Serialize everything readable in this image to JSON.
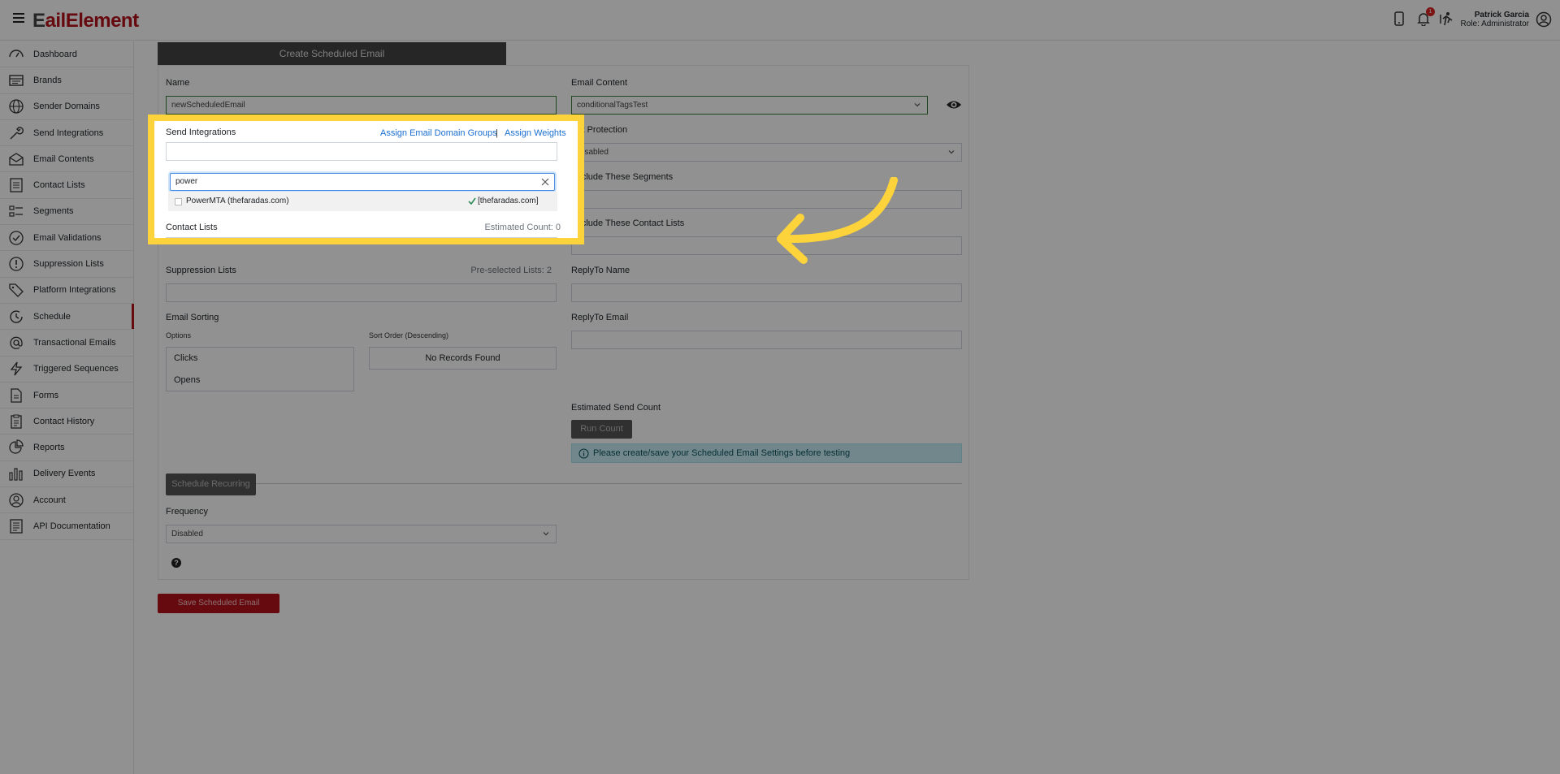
{
  "app": {
    "logo_a": "E",
    "logo_b": "ail",
    "logo_c": "Element"
  },
  "user": {
    "name": "Patrick Garcia",
    "role": "Role: Administrator",
    "notif_count": "1"
  },
  "sidebar": {
    "items": [
      {
        "label": "Dashboard",
        "icon": "gauge-icon"
      },
      {
        "label": "Brands",
        "icon": "window-icon"
      },
      {
        "label": "Sender Domains",
        "icon": "globe-icon"
      },
      {
        "label": "Send Integrations",
        "icon": "wrench-icon"
      },
      {
        "label": "Email Contents",
        "icon": "envelope-icon"
      },
      {
        "label": "Contact Lists",
        "icon": "list-icon"
      },
      {
        "label": "Segments",
        "icon": "segments-icon"
      },
      {
        "label": "Email Validations",
        "icon": "check-circle-icon"
      },
      {
        "label": "Suppression Lists",
        "icon": "exclamation-icon"
      },
      {
        "label": "Platform Integrations",
        "icon": "tag-icon"
      },
      {
        "label": "Schedule",
        "icon": "clock-icon"
      },
      {
        "label": "Transactional Emails",
        "icon": "at-icon"
      },
      {
        "label": "Triggered Sequences",
        "icon": "bolt-icon"
      },
      {
        "label": "Forms",
        "icon": "form-icon"
      },
      {
        "label": "Contact History",
        "icon": "clipboard-icon"
      },
      {
        "label": "Reports",
        "icon": "pie-icon"
      },
      {
        "label": "Delivery Events",
        "icon": "bar-chart-icon"
      },
      {
        "label": "Account",
        "icon": "user-circle-icon"
      },
      {
        "label": "API Documentation",
        "icon": "doc-icon"
      }
    ],
    "active_index": 10
  },
  "form": {
    "tab_title": "Create Scheduled Email",
    "name_label": "Name",
    "name_value": "newScheduledEmail",
    "email_content_label": "Email Content",
    "email_content_value": "conditionalTagsTest",
    "send_integrations_label": "Send Integrations",
    "assign_domain_groups": "Assign Email Domain Groups",
    "link_sep": "|",
    "assign_weights": "Assign Weights",
    "search_value": "power",
    "option_label": "PowerMTA (thefaradas.com)",
    "option_tag": "[thefaradas.com]",
    "bot_protection_label": "Bot Protection",
    "bot_protection_value": "Disabled",
    "exclude_segments_label": "Exclude These Segments",
    "contact_lists_label": "Contact Lists",
    "estimated_count": "Estimated Count: 0",
    "exclude_contact_lists_label": "Exclude These Contact Lists",
    "suppression_lists_label": "Suppression Lists",
    "preselected_lists": "Pre-selected Lists: 2",
    "replyto_name_label": "ReplyTo Name",
    "email_sorting_label": "Email Sorting",
    "options_label": "Options",
    "sort_order_label": "Sort Order (Descending)",
    "options": [
      "Clicks",
      "Opens"
    ],
    "no_records": "No Records Found",
    "replyto_email_label": "ReplyTo Email",
    "estimated_send_count_label": "Estimated Send Count",
    "run_count": "Run Count",
    "info_message": "Please create/save your Scheduled Email Settings before testing",
    "schedule_recurring": "Schedule Recurring",
    "frequency_label": "Frequency",
    "frequency_value": "Disabled",
    "help": "?",
    "save_button": "Save Scheduled Email"
  },
  "colors": {
    "brand": "#b5121b",
    "highlight": "#fdd33b",
    "link": "#1a6fd1"
  }
}
